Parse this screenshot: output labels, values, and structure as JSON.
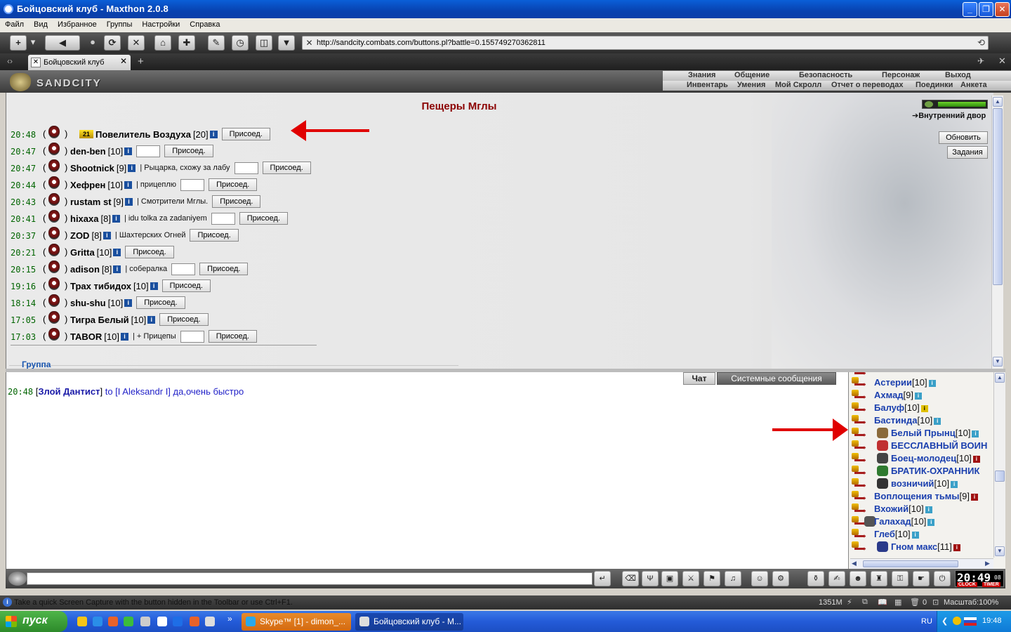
{
  "window": {
    "title": "Бойцовский клуб - Maxthon 2.0.8"
  },
  "menu": [
    "Файл",
    "Вид",
    "Избранное",
    "Группы",
    "Настройки",
    "Справка"
  ],
  "address": {
    "url": "http://sandcity.combats.com/buttons.pl?battle=0.155749270362811"
  },
  "tab": {
    "label": "Бойцовский клуб"
  },
  "site": {
    "logo_text": "SANDCITY",
    "nav_top": [
      "Знания",
      "Общение",
      "Безопасность",
      "Персонаж",
      "Выход"
    ],
    "nav_bottom": [
      "Инвентарь",
      "Умения",
      "Мой Скролл",
      "Отчет о переводах",
      "Поединки",
      "Анкета"
    ]
  },
  "room": {
    "title": "Пещеры Мглы",
    "location": "Внутренний двор",
    "refresh_label": "Обновить",
    "tasks_label": "Задания",
    "join_label": "Присоед.",
    "group_tab": "Группа",
    "applications": [
      {
        "time": "20:48",
        "badge": "21",
        "name": "Повелитель Воздуха",
        "level": "[20]",
        "comment": "",
        "has_input": false
      },
      {
        "time": "20:47",
        "badge": "",
        "name": "den-ben",
        "level": "[10]",
        "comment": "",
        "has_input": true
      },
      {
        "time": "20:47",
        "badge": "",
        "name": "Shootnick",
        "level": "[9]",
        "comment": "| Рыцарка, схожу за лабу",
        "has_input": true
      },
      {
        "time": "20:44",
        "badge": "",
        "name": "Хефрен",
        "level": "[10]",
        "comment": "| прицеплю",
        "has_input": true
      },
      {
        "time": "20:43",
        "badge": "",
        "name": "rustam st",
        "level": "[9]",
        "comment": "| Смотрители Мглы.",
        "has_input": false
      },
      {
        "time": "20:41",
        "badge": "",
        "name": "hixaxa",
        "level": "[8]",
        "comment": "| idu tolka za zadaniyem",
        "has_input": true
      },
      {
        "time": "20:37",
        "badge": "",
        "name": "ZOD",
        "level": "[8]",
        "comment": "| Шахтерских Огней",
        "has_input": false
      },
      {
        "time": "20:21",
        "badge": "",
        "name": "Gritta",
        "level": "[10]",
        "comment": "",
        "has_input": false
      },
      {
        "time": "20:15",
        "badge": "",
        "name": "adison",
        "level": "[8]",
        "comment": "| собералка",
        "has_input": true
      },
      {
        "time": "19:16",
        "badge": "",
        "name": "Трах тибидох",
        "level": "[10]",
        "comment": "",
        "has_input": false
      },
      {
        "time": "18:14",
        "badge": "",
        "name": "shu-shu",
        "level": "[10]",
        "comment": "",
        "has_input": false
      },
      {
        "time": "17:05",
        "badge": "",
        "name": "Тигра Белый",
        "level": "[10]",
        "comment": "",
        "has_input": false
      },
      {
        "time": "17:03",
        "badge": "",
        "name": "TABOR",
        "level": "[10]",
        "comment": "| + Прицепы",
        "has_input": true
      }
    ]
  },
  "chat": {
    "tab_chat": "Чат",
    "tab_system": "Системные сообщения",
    "message": {
      "time": "20:48",
      "sender": "Злой Дантист",
      "text": "to [I Aleksandr I] да,очень быстро"
    }
  },
  "userlist": [
    {
      "name": "Астерии",
      "level": "[10]",
      "indent": false,
      "clan": "",
      "info": "blue"
    },
    {
      "name": "Ахмад",
      "level": "[9]",
      "indent": false,
      "clan": "",
      "info": "blue"
    },
    {
      "name": "Балуф",
      "level": "[10]",
      "indent": false,
      "clan": "",
      "info": "yellow"
    },
    {
      "name": "Бастинда",
      "level": "[10]",
      "indent": false,
      "clan": "",
      "info": "blue"
    },
    {
      "name": "Белый Прынц",
      "level": "[10]",
      "indent": true,
      "clan": "#8a6a3a",
      "info": "blue"
    },
    {
      "name": "БЕССЛАВНЫЙ ВОИН",
      "level": "",
      "indent": true,
      "clan": "#c03030",
      "info": ""
    },
    {
      "name": "Боец-молодец",
      "level": "[10]",
      "indent": true,
      "clan": "#444444",
      "info": "red"
    },
    {
      "name": "БРАТИК-ОХРАННИК",
      "level": "",
      "indent": true,
      "clan": "#2f7a2f",
      "info": ""
    },
    {
      "name": "возничий",
      "level": "[10]",
      "indent": true,
      "clan": "#333333",
      "info": "blue"
    },
    {
      "name": "Воплощения тьмы",
      "level": "[9]",
      "indent": false,
      "clan": "",
      "info": "red"
    },
    {
      "name": "Вхожий",
      "level": "[10]",
      "indent": false,
      "clan": "",
      "info": "blue"
    },
    {
      "name": "Галахад",
      "level": "[10]",
      "indent": false,
      "clan": "#555555",
      "info": "blue"
    },
    {
      "name": "Глеб",
      "level": "[10]",
      "indent": false,
      "clan": "",
      "info": "blue"
    },
    {
      "name": "Гном макс",
      "level": "[11]",
      "indent": true,
      "clan": "#2a3a8a",
      "info": "red"
    }
  ],
  "clock": {
    "time": "20:49",
    "seconds": "08",
    "clock_label": "CLOCK",
    "timer_label": "TIMER"
  },
  "statusbar": {
    "hint": "Take a quick Screen Capture with the button hidden in the Toolbar or use Ctrl+F1.",
    "memory": "1351M",
    "zero": "0",
    "zoom": "Масштаб:100%"
  },
  "taskbar": {
    "start": "пуск",
    "tasks": [
      {
        "label": "Skype™ [1] - dimon_..."
      },
      {
        "label": "Бойцовский клуб - M..."
      }
    ],
    "lang": "RU",
    "time": "19:48"
  },
  "colors": {
    "room_title": "#8b0000",
    "time": "#006400",
    "user_name": "#1a3fae",
    "arrow": "#e00000"
  }
}
